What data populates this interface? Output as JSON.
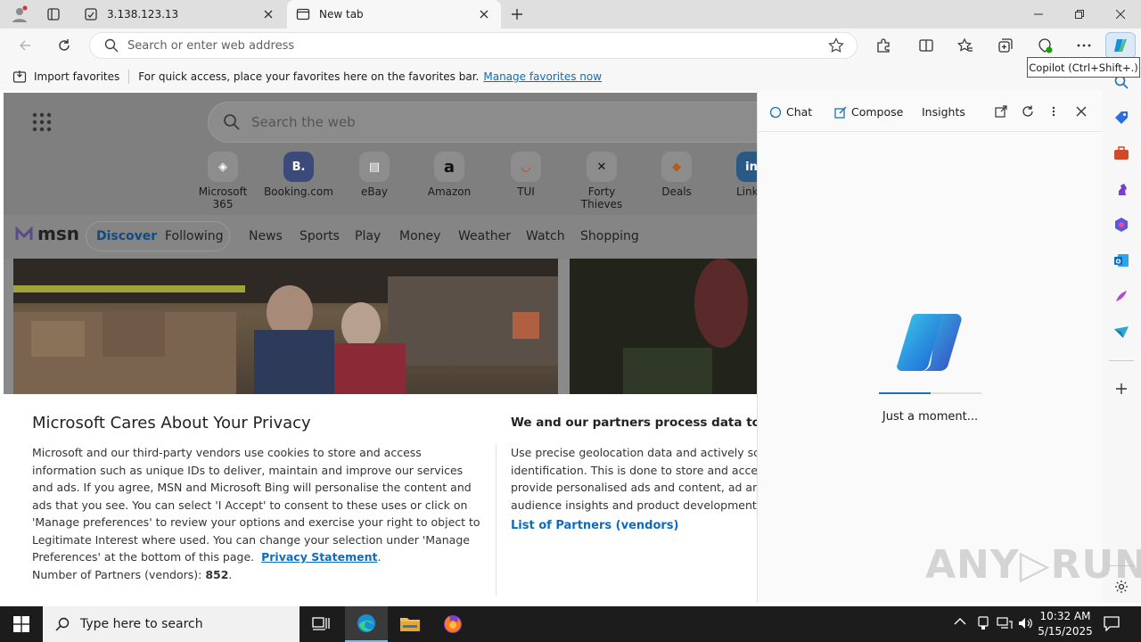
{
  "browser": {
    "tabs": [
      {
        "title": "3.138.123.13",
        "active": false
      },
      {
        "title": "New tab",
        "active": true
      }
    ],
    "address_placeholder": "Search or enter web address",
    "favorites_bar": {
      "import_label": "Import favorites",
      "message": "For quick access, place your favorites here on the favorites bar.",
      "manage_link": "Manage favorites now"
    },
    "tooltip": "Copilot (Ctrl+Shift+.)"
  },
  "page": {
    "search_placeholder": "Search the web",
    "quick_links": [
      {
        "label": "Microsoft 365",
        "glyph": "◈"
      },
      {
        "label": "Booking.com",
        "glyph": "B."
      },
      {
        "label": "eBay",
        "glyph": "▤"
      },
      {
        "label": "Amazon",
        "glyph": "a"
      },
      {
        "label": "TUI",
        "glyph": "◡"
      },
      {
        "label": "Forty Thieves",
        "glyph": "✕"
      },
      {
        "label": "Deals",
        "glyph": "◆"
      },
      {
        "label": "Linke",
        "glyph": "in"
      }
    ],
    "msn": {
      "logo_text": "msn",
      "pill_tabs": [
        "Discover",
        "Following"
      ],
      "nav": [
        "News",
        "Sports",
        "Play",
        "Money",
        "Weather",
        "Watch",
        "Shopping"
      ]
    },
    "consent": {
      "title": "Microsoft Cares About Your Privacy",
      "body": "Microsoft and our third-party vendors use cookies to store and access information such as unique IDs to deliver, maintain and improve our services and ads. If you agree, MSN and Microsoft Bing will personalise the content and ads that you see. You can select 'I Accept' to consent to these uses or click on 'Manage preferences' to review your options and exercise your right to object to Legitimate Interest where used.  You can change your selection under 'Manage Preferences' at the bottom of this page.",
      "privacy_link": "Privacy Statement",
      "partners_prefix": "Number of Partners (vendors):",
      "partners_count": "852",
      "right_title": "We and our partners process data to provide",
      "right_body": "Use precise geolocation data and actively scan identification. This is done to store and access i provide personalised ads and content, ad and c audience insights and product development.",
      "partners_link": "List of Partners (vendors)"
    }
  },
  "copilot": {
    "tabs": [
      "Chat",
      "Compose",
      "Insights"
    ],
    "status": "Just a moment...",
    "progress": 0.5
  },
  "taskbar": {
    "search_placeholder": "Type here to search",
    "time": "10:32 AM",
    "date": "5/15/2025"
  },
  "watermark": "ANY▷RUN",
  "colors": {
    "accent": "#0f6cbd",
    "taskbar": "#1c1c1c"
  }
}
